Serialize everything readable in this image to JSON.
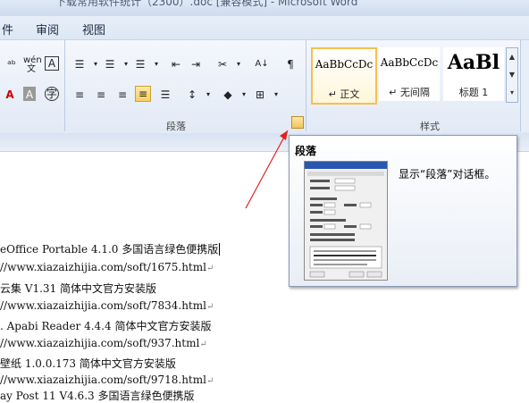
{
  "window": {
    "title": "下载常用软件统计（2300）.doc [兼容模式] - Microsoft Word"
  },
  "menu": {
    "items": [
      "件",
      "审阅",
      "视图"
    ]
  },
  "ribbon": {
    "paragraph_group_label": "段落",
    "styles_group_label": "样式",
    "styles": [
      {
        "sample": "AaBbCcDc",
        "name": "↵ 正文"
      },
      {
        "sample": "AaBbCcDc",
        "name": "↵ 无间隔"
      },
      {
        "sample": "AaBl",
        "name": "标题 1"
      }
    ]
  },
  "tooltip": {
    "title": "段落",
    "description": "显示“段落”对话框。"
  },
  "document": {
    "lines": [
      "eOffice Portable 4.1.0 多国语言绿色便携版",
      "//www.xiazaizhijia.com/soft/1675.html",
      "云集  V1.31  简体中文官方安装版",
      "//www.xiazaizhijia.com/soft/7834.html",
      ". Apabi Reader 4.4.4  简体中文官方安装版",
      "//www.xiazaizhijia.com/soft/937.html",
      "壁纸  1.0.0.173  简体中文官方安装版",
      "//www.xiazaizhijia.com/soft/9718.html",
      "ay Post 11  V4.6.3 多国语言绿色便携版"
    ],
    "paragraph_mark": "↵"
  },
  "colors": {
    "accent": "#f2c14e",
    "arrow": "#e02020",
    "ribbon": "#e2eaf6"
  },
  "icons": [
    "phonetic-guide-icon",
    "char-border-icon",
    "bullets-icon",
    "numbering-icon",
    "multilevel-list-icon",
    "decrease-indent-icon",
    "increase-indent-icon",
    "chinese-layout-icon",
    "sort-icon",
    "show-marks-icon",
    "font-color-icon",
    "char-shading-icon",
    "enclose-char-icon",
    "align-left-icon",
    "center-icon",
    "align-right-icon",
    "justify-icon",
    "distributed-icon",
    "line-spacing-icon",
    "shading-icon",
    "borders-icon",
    "dialog-launcher-icon"
  ]
}
